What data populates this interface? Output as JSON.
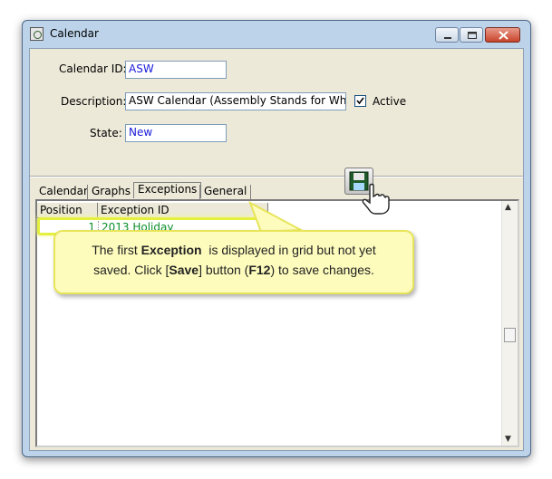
{
  "window": {
    "title": "Calendar",
    "icon": "calendar-app-icon",
    "buttons": [
      "minimize-icon",
      "maximize-icon",
      "close-icon"
    ]
  },
  "form": {
    "calendar_id_label": "Calendar ID:",
    "calendar_id_value": "ASW",
    "description_label": "Description:",
    "description_value": "ASW Calendar (Assembly Stands for Wheels)",
    "active_label": "Active",
    "active_checked": true,
    "state_label": "State:",
    "state_value": "New"
  },
  "tabs": [
    {
      "label": "Calendar"
    },
    {
      "label": "Graphs"
    },
    {
      "label": "Exceptions",
      "active": true
    },
    {
      "label": "General"
    }
  ],
  "grid": {
    "columns": [
      "Position",
      "Exception ID"
    ],
    "rows": [
      {
        "position": "1",
        "exception_id": "2013 Holiday"
      }
    ]
  },
  "callout": {
    "line1_prefix": "The first ",
    "line1_bold": "Exception",
    "line1_suffix": "  is displayed in grid but not yet",
    "line2_a": "saved. Click [",
    "line2_bold1": "Save",
    "line2_b": "] button (",
    "line2_bold2": "F12",
    "line2_c": ") to save changes."
  },
  "colors": {
    "grid_row_text": "#0b8f2b",
    "field_value_text": "#1a1adb",
    "callout_background": "#fdfcbd",
    "highlight": "#e4f03d"
  },
  "icons": [
    "save-icon",
    "hand-pointer-icon"
  ]
}
